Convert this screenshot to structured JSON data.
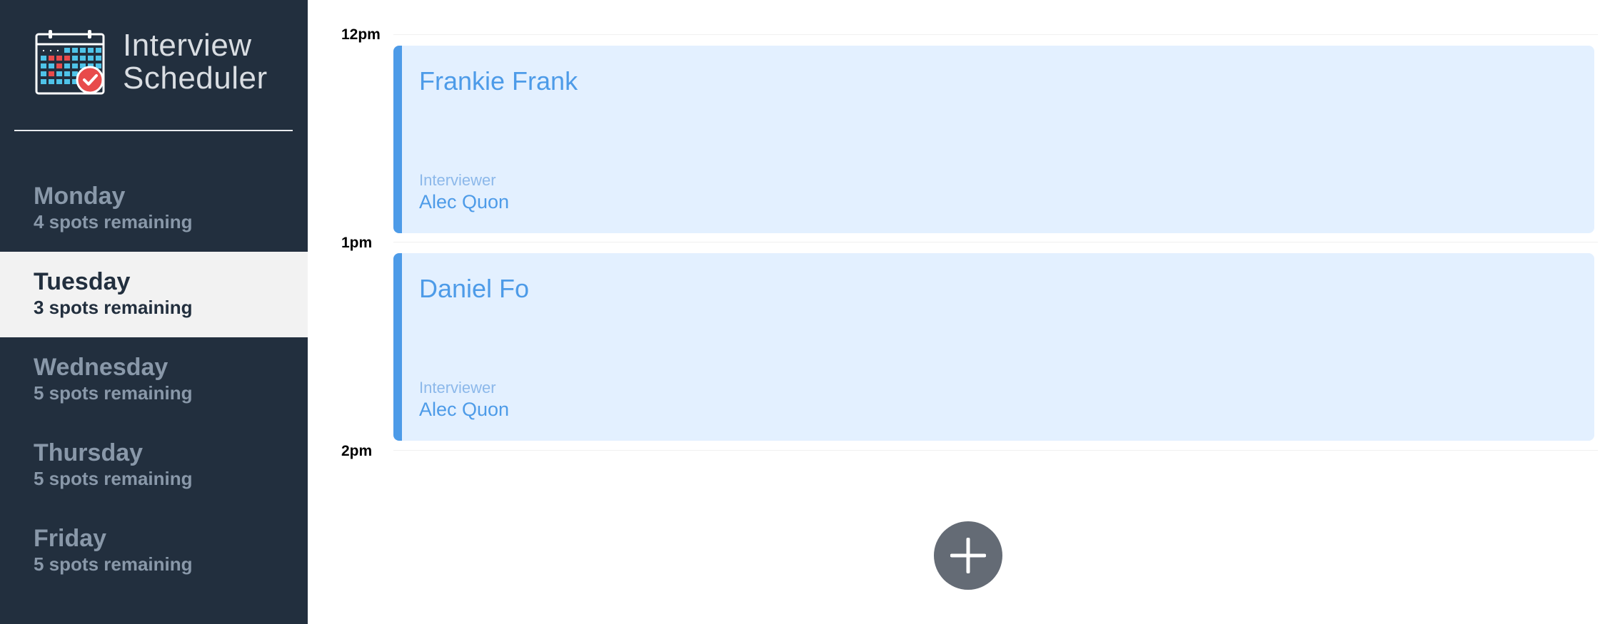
{
  "app": {
    "title_line1": "Interview",
    "title_line2": "Scheduler",
    "logo_icon": "calendar-check-icon"
  },
  "sidebar": {
    "days": [
      {
        "name": "Monday",
        "spots": "4 spots remaining",
        "selected": false
      },
      {
        "name": "Tuesday",
        "spots": "3 spots remaining",
        "selected": true
      },
      {
        "name": "Wednesday",
        "spots": "5 spots remaining",
        "selected": false
      },
      {
        "name": "Thursday",
        "spots": "5 spots remaining",
        "selected": false
      },
      {
        "name": "Friday",
        "spots": "5 spots remaining",
        "selected": false
      }
    ]
  },
  "schedule": {
    "times": [
      "12pm",
      "1pm",
      "2pm"
    ],
    "appointments": [
      {
        "student": "Frankie Frank",
        "interviewer_label": "Interviewer",
        "interviewer": "Alec Quon"
      },
      {
        "student": "Daniel Fo",
        "interviewer_label": "Interviewer",
        "interviewer": "Alec Quon"
      }
    ],
    "add_button_icon": "plus-icon"
  },
  "colors": {
    "sidebar_bg": "#222f3e",
    "selected_bg": "#f2f2f2",
    "appointment_bg": "#e3f0ff",
    "accent": "#4d9be8",
    "add_button_bg": "#646b75"
  }
}
